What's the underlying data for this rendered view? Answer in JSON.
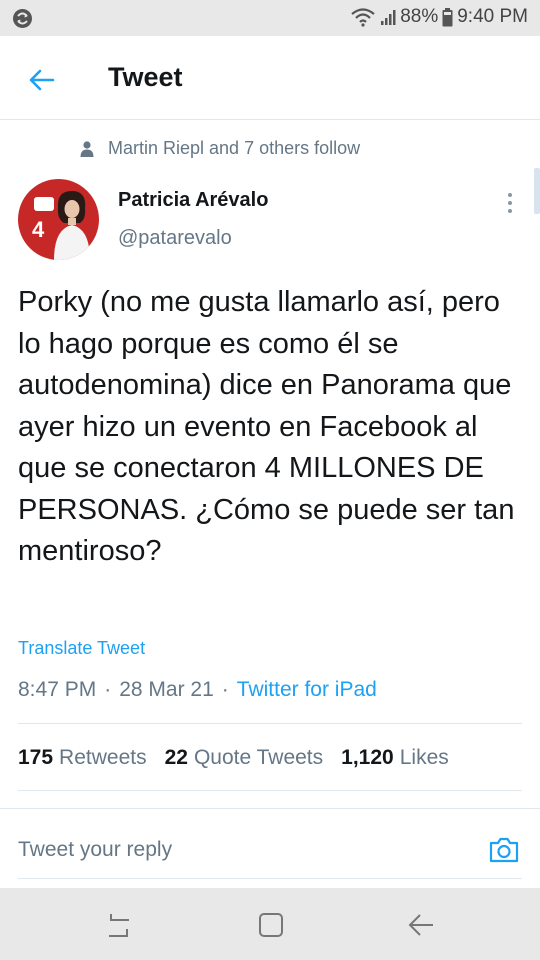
{
  "status_bar": {
    "battery": "88%",
    "time": "9:40 PM",
    "icons": [
      "sync-icon",
      "wifi-icon",
      "signal-icon",
      "battery-icon"
    ]
  },
  "header": {
    "title": "Tweet",
    "back_icon": "arrow-left-icon"
  },
  "social_context": {
    "text": "Martin Riepl and 7 others follow",
    "icon": "person-icon"
  },
  "author": {
    "name": "Patricia Arévalo",
    "handle": "@patarevalo",
    "avatar_number": "4"
  },
  "tweet": {
    "text": "Porky (no me gusta llamarlo así, pero lo hago porque es como él se autodenomina) dice en Panorama que ayer hizo un evento en Facebook al que se conectaron 4 MILLONES DE PERSONAS. ¿Cómo se puede ser tan mentiroso?",
    "translate_label": "Translate Tweet",
    "time": "8:47 PM",
    "date": "28 Mar 21",
    "source": "Twitter for iPad",
    "separator": "·"
  },
  "stats": {
    "retweets_count": "175",
    "retweets_label": "Retweets",
    "quotes_count": "22",
    "quotes_label": "Quote Tweets",
    "likes_count": "1,120",
    "likes_label": "Likes"
  },
  "reply": {
    "placeholder": "Tweet your reply",
    "camera_icon": "camera-icon"
  },
  "colors": {
    "accent": "#1da1f2",
    "text_primary": "#14171a",
    "text_secondary": "#657786",
    "avatar_bg": "#c62828",
    "system_bar": "#e8e8e8"
  },
  "nav_bar": {
    "icons": [
      "recents-icon",
      "home-icon",
      "back-icon"
    ]
  }
}
